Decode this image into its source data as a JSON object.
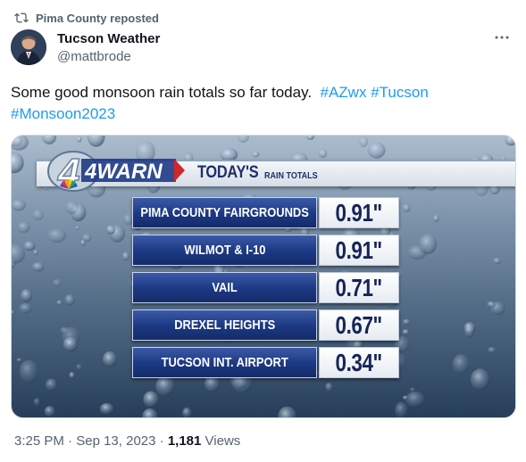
{
  "repost": {
    "text": "Pima County reposted",
    "icon": "repost-icon"
  },
  "author": {
    "name": "Tucson Weather",
    "handle": "@mattbrode",
    "avatar": "avatar"
  },
  "more_icon": "more-options-icon",
  "tweet": {
    "text": "Some good monsoon rain totals so far today.",
    "hashtags": [
      "#AZwx",
      "#Tucson",
      "#Monsoon2023"
    ]
  },
  "graphic": {
    "brand": "4WARN",
    "title": "TODAY'S",
    "subtitle": "RAIN TOTALS",
    "rows": [
      {
        "location": "PIMA COUNTY FAIRGROUNDS",
        "value": "0.91\""
      },
      {
        "location": "WILMOT & I-10",
        "value": "0.91\""
      },
      {
        "location": "VAIL",
        "value": "0.71\""
      },
      {
        "location": "DREXEL HEIGHTS",
        "value": "0.67\""
      },
      {
        "location": "TUCSON INT. AIRPORT",
        "value": "0.34\""
      }
    ],
    "colors": {
      "panel_blue": "#1e3a85",
      "value_text": "#15255a",
      "accent_red": "#d3262c"
    }
  },
  "meta": {
    "time": "3:25 PM",
    "date": "Sep 13, 2023",
    "views_count": "1,181",
    "views_label": "Views"
  },
  "colors": {
    "link": "#1d9bf0",
    "secondary_text": "#536471",
    "primary_text": "#0f1419"
  }
}
